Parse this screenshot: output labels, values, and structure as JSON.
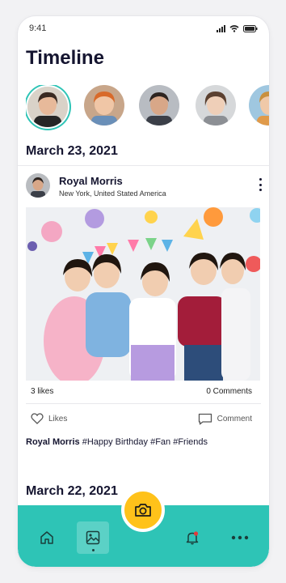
{
  "status_bar": {
    "time": "9:41"
  },
  "header": {
    "title": "Timeline"
  },
  "stories": [
    "story-1",
    "story-2",
    "story-3",
    "story-4",
    "story-5"
  ],
  "feed": {
    "sections": [
      {
        "date": "March 23, 2021",
        "post": {
          "author": "Royal Morris",
          "location": "New York, United Stated America",
          "likes": "3 likes",
          "comments": "0 Comments",
          "like_label": "Likes",
          "comment_label": "Comment",
          "caption_author": "Royal Morris",
          "caption_text": "#Happy Birthday #Fan #Friends"
        }
      },
      {
        "date": "March 22, 2021"
      }
    ]
  },
  "icons": {
    "more": "more-vertical-icon",
    "like": "heart-icon",
    "comment": "comment-icon",
    "home": "home-icon",
    "gallery": "image-icon",
    "camera": "camera-icon",
    "notifications": "bell-icon",
    "more_menu": "more-horizontal-icon"
  },
  "colors": {
    "accent": "#2ec4b6",
    "camera": "#ffc21a",
    "text": "#151530",
    "notification_dot": "#e23b3b"
  }
}
